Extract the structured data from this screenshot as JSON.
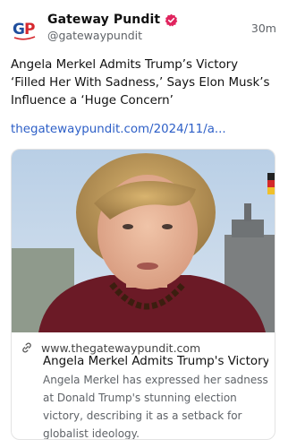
{
  "account": {
    "avatar_text": "GP",
    "name": "Gateway Pundit",
    "handle": "@gatewaypundit",
    "time": "30m",
    "verified_icon": "verified-badge-icon",
    "colors": {
      "avatar_blue": "#1f4e9d",
      "avatar_red": "#d6282e",
      "verified": "#e0245e"
    }
  },
  "post": {
    "text": "Angela Merkel Admits Trump’s Victory ‘Filled Her With Sadness,’ Says Elon Musk’s Influence a ‘Huge Concern’",
    "link": "thegatewaypundit.com/2024/11/a...",
    "link_color": "#2d5fc7"
  },
  "card": {
    "image_alt": "Angela Merkel portrait",
    "link_icon": "link-icon",
    "domain": "www.thegatewaypundit.com",
    "title": "Angela Merkel Admits Trump's Victory...",
    "description": "Angela Merkel has expressed her sadness at Donald Trump's stunning election victory, describing it as a setback for globalist ideology."
  }
}
